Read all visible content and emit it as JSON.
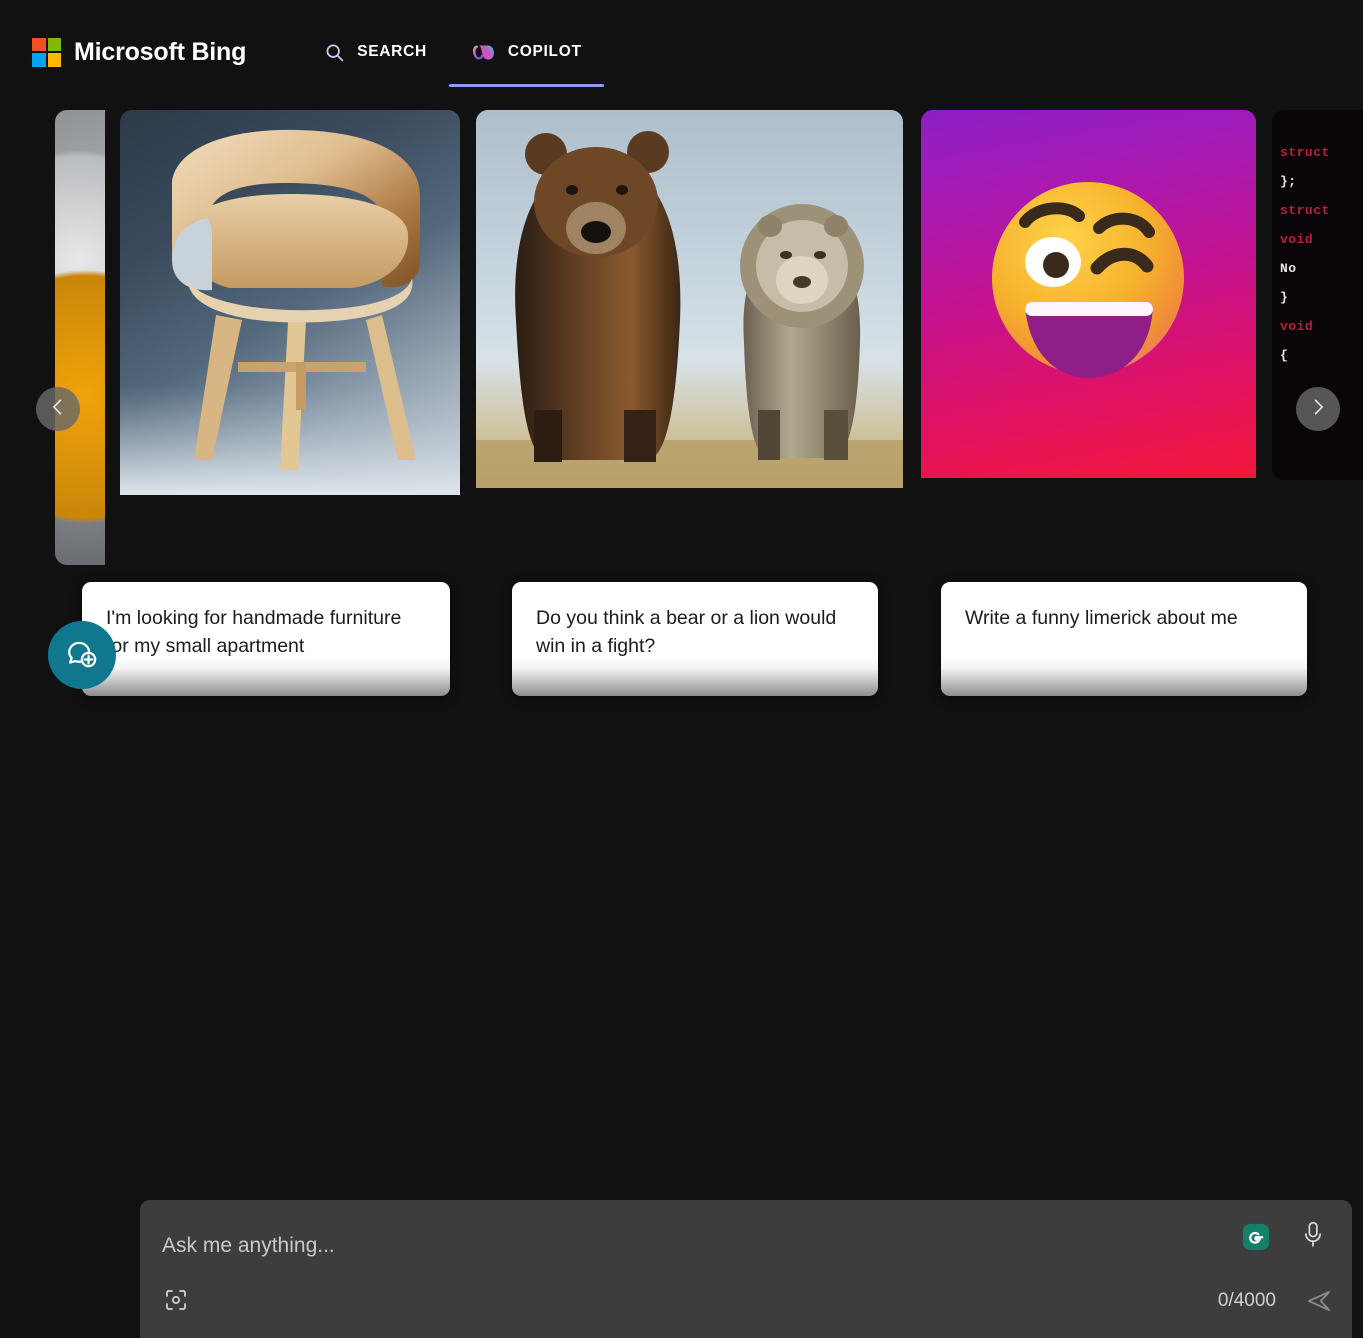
{
  "header": {
    "brand_name": "Microsoft Bing",
    "logo_colors": [
      "#f25022",
      "#7fba00",
      "#00a4ef",
      "#ffb900"
    ],
    "nav": [
      {
        "label": "SEARCH",
        "icon": "search-icon",
        "active": false
      },
      {
        "label": "COPILOT",
        "icon": "copilot-icon",
        "active": true
      }
    ],
    "active_tab_underline_color": "#8d9bf0"
  },
  "carousel": {
    "prev_label": "‹",
    "next_label": "›",
    "cards": [
      {
        "id": "machine",
        "image_alt": "metallic machine parts with orange dial",
        "caption": "",
        "partial": true
      },
      {
        "id": "furniture",
        "image_alt": "wooden armchair on blue-grey gradient background",
        "caption": "I'm looking for handmade furniture for my small apartment",
        "partial": false
      },
      {
        "id": "animals",
        "image_alt": "brown bear and lion standing in a field",
        "caption": "Do you think a bear or a lion would win in a fight?",
        "partial": false
      },
      {
        "id": "emoji",
        "image_alt": "winking smiley face emoji on magenta gradient",
        "caption": "Write a funny limerick about me",
        "partial": false
      },
      {
        "id": "code",
        "image_alt": "source code on black background",
        "caption": "",
        "partial": true,
        "code_lines": [
          "struct",
          "};",
          "struct",
          "void",
          "No",
          "}",
          "void",
          "{"
        ]
      }
    ]
  },
  "composer": {
    "new_chat_icon": "chat-plus-icon",
    "new_chat_color": "#10788e",
    "placeholder": "Ask me anything...",
    "value": "",
    "counter": "0/4000",
    "camera_icon": "visual-search-camera-icon",
    "grammarly_icon": "grammarly-icon",
    "grammarly_color": "#15806a",
    "mic_icon": "microphone-icon",
    "send_icon": "send-icon"
  }
}
